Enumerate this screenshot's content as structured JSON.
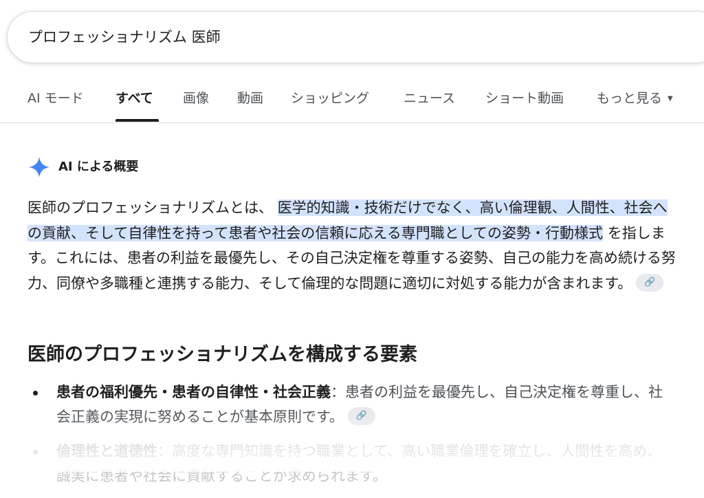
{
  "search": {
    "query": "プロフェッショナリズム 医師"
  },
  "tabs": [
    {
      "label": "AI モード"
    },
    {
      "label": "すべて"
    },
    {
      "label": "画像"
    },
    {
      "label": "動画"
    },
    {
      "label": "ショッピング"
    },
    {
      "label": "ニュース"
    },
    {
      "label": "ショート動画"
    },
    {
      "label": "もっと見る"
    }
  ],
  "active_tab": "すべて",
  "ai_overview": {
    "title": "AI による概要",
    "icon": "sparkle-icon",
    "para_start": "医師のプロフェッショナリズムとは、",
    "para_highlight": "医学的知識・技術だけでなく、高い倫理観、人間性、社会への貢献、そして自律性を持って患者や社会の信頼に応える専門職としての姿勢・行動様式",
    "para_end": "を指します。これには、患者の利益を最優先し、その自己決定権を尊重する姿勢、自己の能力を高め続ける努力、同僚や多職種と連携する能力、そして倫理的な問題に適切に対処する能力が含まれます。",
    "heading": "医師のプロフェッショナリズムを構成する要素",
    "bullets": [
      {
        "term": "患者の福利優先・患者の自律性・社会正義",
        "text": "：患者の利益を最優先し、自己決定権を尊重し、社会正義の実現に努めることが基本原則です。"
      },
      {
        "term": "倫理性と道徳性",
        "text": "：高度な専門知識を持つ職業として、高い職業倫理を確立し、人間性を高め、誠実に患者や社会に貢献することが求められます。"
      }
    ]
  },
  "colors": {
    "highlight": "#d3e3fd",
    "sparkle": "#4285f4"
  }
}
